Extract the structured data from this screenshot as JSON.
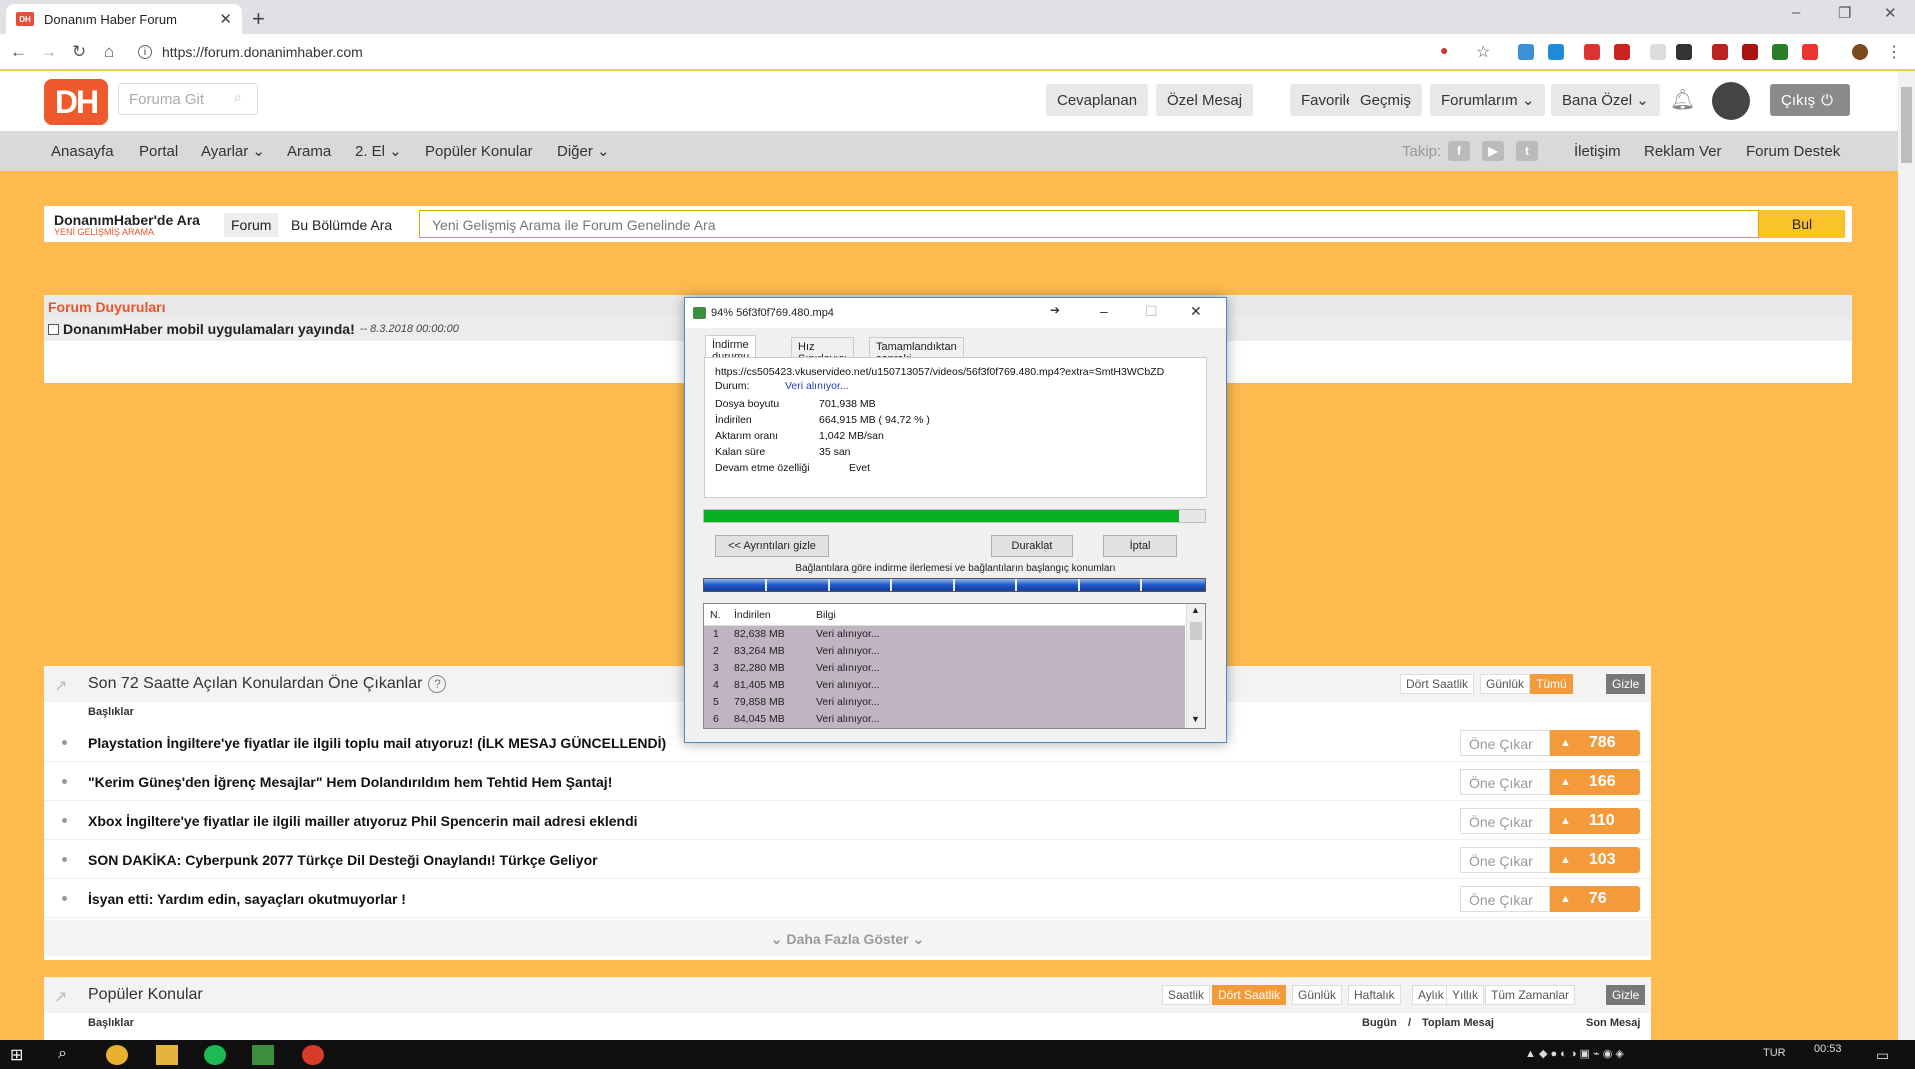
{
  "browser": {
    "tab_title": "Donanım Haber Forum",
    "favicon_text": "DH",
    "url": "https://forum.donanimhaber.com"
  },
  "header": {
    "logo_text": "DH",
    "search_placeholder": "Foruma Git",
    "buttons": [
      "Cevaplanan",
      "Özel Mesaj",
      "Favoriler",
      "Geçmiş",
      "Forumlarım ⌄",
      "Bana Özel ⌄"
    ],
    "logout_label": "Çıkış"
  },
  "nav": {
    "items": [
      "Anasayfa",
      "Portal",
      "Ayarlar ⌄",
      "Arama",
      "2. El ⌄",
      "Popüler Konular",
      "Diğer ⌄"
    ],
    "follow_label": "Takip:",
    "right_items": [
      "İletişim",
      "Reklam Ver",
      "Forum Destek"
    ]
  },
  "search": {
    "title": "DonanımHaber'de Ara",
    "subtitle": "YENİ GELİŞMİŞ ARAMA",
    "tabs": [
      "Forum",
      "Bu Bölümde Ara"
    ],
    "placeholder": "Yeni Gelişmiş Arama ile Forum Genelinde Ara",
    "button": "Bul"
  },
  "announcements": {
    "title": "Forum Duyuruları",
    "item": "DonanımHaber mobil uygulamaları yayında!",
    "date": "-- 8.3.2018 00:00:00"
  },
  "trending": {
    "title": "Son 72 Saatte Açılan Konulardan Öne Çıkanlar",
    "filters": [
      "Dört Saatlik",
      "Günlük",
      "Tümü"
    ],
    "hide": "Gizle",
    "column": "Başlıklar",
    "featured_label": "Öne Çıkar",
    "topics": [
      {
        "title": "Playstation İngiltere'ye fiyatlar ile ilgili toplu mail atıyoruz! (İLK MESAJ GÜNCELLENDİ)",
        "votes": "786"
      },
      {
        "title": "\"Kerim Güneş'den İğrenç Mesajlar\" Hem Dolandırıldım hem Tehtid Hem Şantaj!",
        "votes": "166"
      },
      {
        "title": "Xbox İngiltere'ye fiyatlar ile ilgili mailler atıyoruz Phil Spencerin mail adresi eklendi",
        "votes": "110"
      },
      {
        "title": "SON DAKİKA: Cyberpunk 2077 Türkçe Dil Desteği Onaylandı! Türkçe Geliyor",
        "votes": "103"
      },
      {
        "title": "İsyan etti: Yardım edin, sayaçları okutmuyorlar !",
        "votes": "76"
      }
    ],
    "show_more": "Daha Fazla Göster"
  },
  "popular": {
    "title": "Popüler Konular",
    "filters": [
      "Saatlik",
      "Dört Saatlik",
      "Günlük",
      "Haftalık",
      "Aylık",
      "Yıllık",
      "Tüm Zamanlar"
    ],
    "hide": "Gizle",
    "column": "Başlıklar",
    "col_today": "Bugün",
    "col_sep": "/",
    "col_total": "Toplam Mesaj",
    "col_last": "Son Mesaj"
  },
  "download_dialog": {
    "title": "94% 56f3f0f769.480.mp4",
    "tabs": [
      "İndirme durumu",
      "Hız Sınırlayıcı",
      "Tamamlandıktan sonraki seçenekler"
    ],
    "url": "https://cs505423.vkuservideo.net/u150713057/videos/56f3f0f769.480.mp4?extra=SmtH3WCbZD",
    "status_label": "Durum:",
    "status_value": "Veri alınıyor...",
    "fields": [
      {
        "label": "Dosya boyutu",
        "value": "701,938  MB"
      },
      {
        "label": "İndirilen",
        "value": "664,915  MB  ( 94,72 % )"
      },
      {
        "label": "Aktarım oranı",
        "value": "1,042  MB/san"
      },
      {
        "label": "Kalan süre",
        "value": "35 san"
      }
    ],
    "resume_label": "Devam etme özelliği",
    "resume_value": "Evet",
    "progress": 0.9472,
    "buttons": {
      "details": "<< Ayrıntıları gizle",
      "pause": "Duraklat",
      "cancel": "İptal"
    },
    "connections_caption": "Bağlantılara göre indirme ilerlemesi ve bağlantıların başlangıç konumları",
    "columns": [
      "N.",
      "İndirilen",
      "Bilgi"
    ],
    "rows": [
      {
        "n": "1",
        "downloaded": "82,638  MB",
        "info": "Veri alınıyor..."
      },
      {
        "n": "2",
        "downloaded": "83,264  MB",
        "info": "Veri alınıyor..."
      },
      {
        "n": "3",
        "downloaded": "82,280  MB",
        "info": "Veri alınıyor..."
      },
      {
        "n": "4",
        "downloaded": "81,405  MB",
        "info": "Veri alınıyor..."
      },
      {
        "n": "5",
        "downloaded": "79,858  MB",
        "info": "Veri alınıyor..."
      },
      {
        "n": "6",
        "downloaded": "84,045  MB",
        "info": "Veri alınıyor..."
      }
    ]
  },
  "taskbar": {
    "language": "TUR",
    "time": "00:53"
  }
}
